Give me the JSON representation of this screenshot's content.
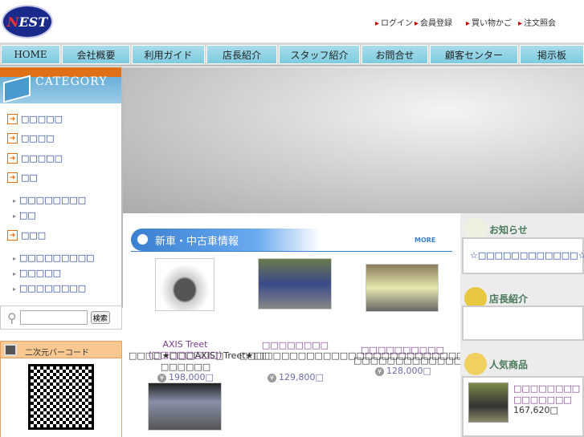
{
  "header": {
    "logo": "NEST",
    "links": [
      "ログイン",
      "会員登録",
      "買い物かご",
      "注文照会"
    ]
  },
  "nav": [
    "HOME",
    "会社概要",
    "利用ガイド",
    "店長紹介",
    "スタッフ紹介",
    "お問合せ",
    "顧客センター",
    "掲示板"
  ],
  "sidebar": {
    "category_title": "CATEGORY",
    "categories": [
      {
        "label": "□□□□□"
      },
      {
        "label": "□□□□"
      },
      {
        "label": "□□□□□"
      },
      {
        "label": "□□",
        "subs": [
          "□□□□□□□□",
          "□□"
        ]
      },
      {
        "label": "□□□",
        "subs": [
          "□□□□□□□□□",
          "□□□□□",
          "□□□□□□□□"
        ]
      }
    ],
    "search_button": "検索",
    "search_value": "",
    "qr_title": "二次元バーコード"
  },
  "main": {
    "section_title": "新車・中古車情報",
    "more": "MORE",
    "products": [
      {
        "title": "AXIS Treet (□□□□□□□□)",
        "desc": "□□□□★□□□AXIS□Treet★□□ □□□□□□",
        "price": "198,000□"
      },
      {
        "title": "□□□□□□□□",
        "desc": "□□□□□□□□□□□□□□□□□□□□□□□□□□□□□□",
        "price": "129,800□"
      },
      {
        "title": "□□□□□□□□□□",
        "desc": "□□□□□□□□□□□□□□",
        "price": "128,000□"
      }
    ]
  },
  "right": {
    "news_title": "お知らせ",
    "news_item": "☆□□□□□□□□□□□□☆",
    "manager_title": "店長紹介",
    "popular_title": "人気商品",
    "popular_item": {
      "title": "□□□□□□□□□□□□□□□",
      "price": "167,620□"
    }
  }
}
